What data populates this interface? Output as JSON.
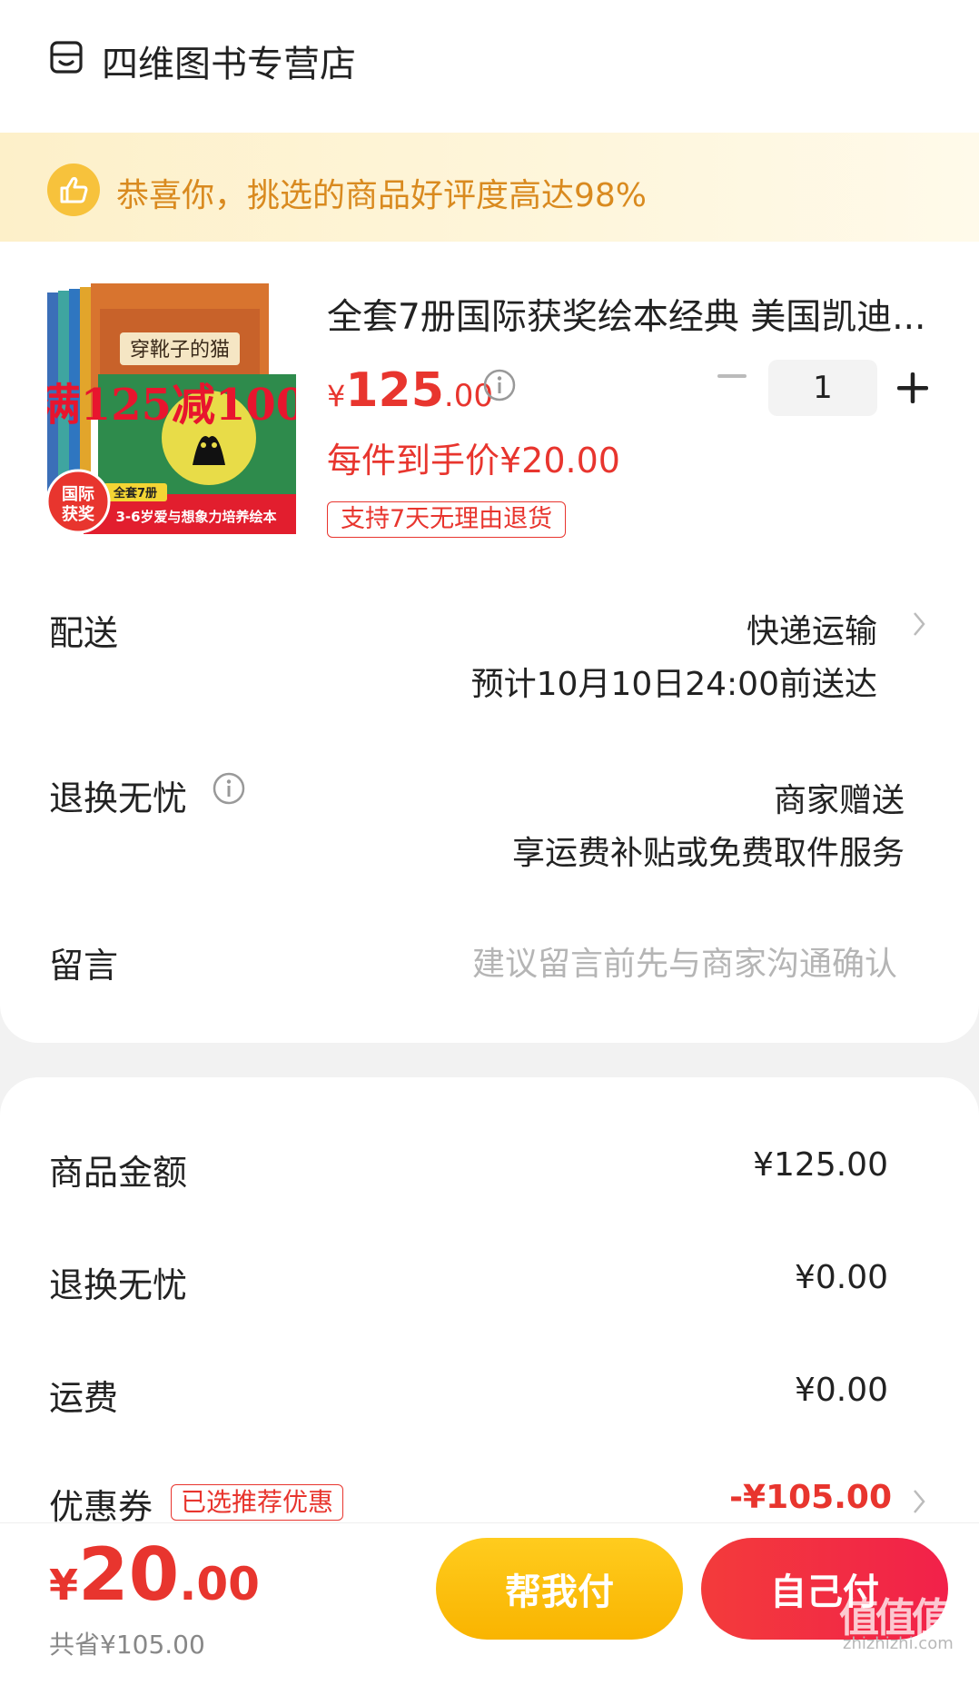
{
  "store": {
    "name": "四维图书专营店",
    "icon": "store-icon"
  },
  "banner": {
    "text": "恭喜你，挑选的商品好评度高达98%",
    "icon": "thumbs-up-icon"
  },
  "product": {
    "image_overlay": {
      "promo": "满125减100",
      "book_title": "穿靴子的猫",
      "badge": "国际获奖",
      "set_label": "全套7册",
      "ribbon": "3-6岁爱与想象力培养绘本"
    },
    "title": "全套7册国际获奖绘本经典 美国凯迪...",
    "price_symbol": "¥",
    "price_int": "125",
    "price_dec": ".00",
    "per_item_price": "每件到手价¥20.00",
    "return_tag": "支持7天无理由退货",
    "quantity": "1"
  },
  "delivery": {
    "label": "配送",
    "method": "快递运输",
    "eta": "预计10月10日24:00前送达"
  },
  "return_guarantee": {
    "label": "退换无忧",
    "value": "商家赠送",
    "desc": "享运费补贴或免费取件服务"
  },
  "message": {
    "label": "留言",
    "placeholder": "建议留言前先与商家沟通确认"
  },
  "summary": {
    "goods_label": "商品金额",
    "goods_value": "¥125.00",
    "return_label": "退换无忧",
    "return_value": "¥0.00",
    "shipping_label": "运费",
    "shipping_value": "¥0.00",
    "coupon_label": "优惠券",
    "coupon_tag": "已选推荐优惠",
    "coupon_value": "-¥105.00"
  },
  "footer": {
    "total_symbol": "¥",
    "total_int": "20",
    "total_dec": ".00",
    "saved": "共省¥105.00",
    "help_pay": "帮我付",
    "self_pay": "自己付"
  },
  "watermark": {
    "main": "值值值",
    "sub": "zhizhizhi.com"
  },
  "colors": {
    "accent_red": "#e8352e",
    "banner_orange": "#d98a1f",
    "help_yellow": "#f9b400"
  }
}
